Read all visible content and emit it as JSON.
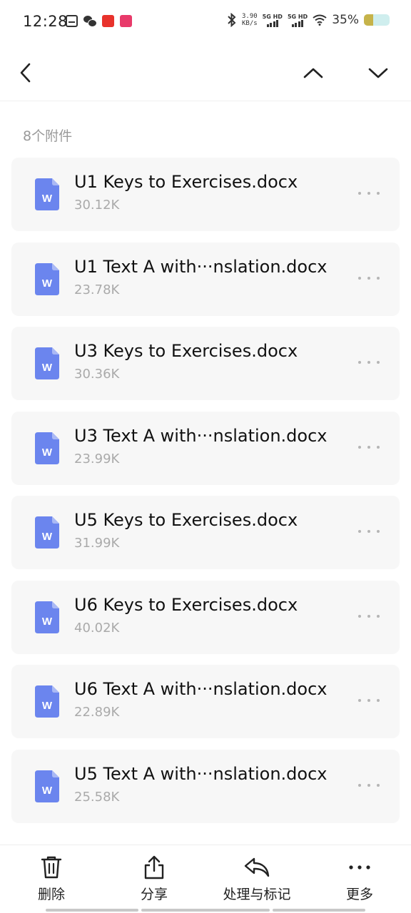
{
  "status_bar": {
    "time": "12:28",
    "net_speed_value": "3.90",
    "net_speed_unit": "KB/s",
    "sim1_label": "5G HD",
    "sim2_label": "5G HD",
    "battery_percent": "35%",
    "battery_level": 0.35
  },
  "attachments": {
    "count_label": "8个附件",
    "items": [
      {
        "name": "U1 Keys to Exercises.docx",
        "size": "30.12K",
        "icon_letter": "W"
      },
      {
        "name": "U1 Text A with···nslation.docx",
        "size": "23.78K",
        "icon_letter": "W"
      },
      {
        "name": "U3 Keys to Exercises.docx",
        "size": "30.36K",
        "icon_letter": "W"
      },
      {
        "name": "U3 Text A with···nslation.docx",
        "size": "23.99K",
        "icon_letter": "W"
      },
      {
        "name": "U5 Keys to Exercises.docx",
        "size": "31.99K",
        "icon_letter": "W"
      },
      {
        "name": "U6 Keys to Exercises.docx",
        "size": "40.02K",
        "icon_letter": "W"
      },
      {
        "name": "U6 Text A with···nslation.docx",
        "size": "22.89K",
        "icon_letter": "W"
      },
      {
        "name": "U5 Text A with···nslation.docx",
        "size": "25.58K",
        "icon_letter": "W"
      }
    ]
  },
  "toolbar": {
    "delete_label": "删除",
    "share_label": "分享",
    "handle_label": "处理与标记",
    "more_label": "更多"
  },
  "icons": {
    "doc": "word-document-icon",
    "accent_color": "#6b85ee"
  }
}
